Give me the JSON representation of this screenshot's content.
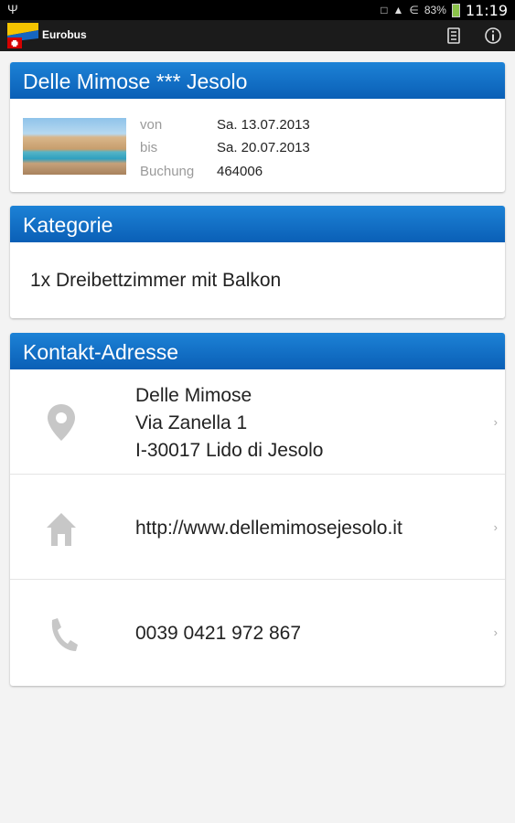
{
  "status_bar": {
    "battery_percent": "83%",
    "time": "11:19"
  },
  "action_bar": {
    "title": "Eurobus"
  },
  "hotel_card": {
    "title": "Delle Mimose *** Jesolo",
    "rows": [
      {
        "label": "von",
        "value": "Sa. 13.07.2013"
      },
      {
        "label": "bis",
        "value": "Sa. 20.07.2013"
      },
      {
        "label": "Buchung",
        "value": "464006"
      }
    ]
  },
  "category_card": {
    "title": "Kategorie",
    "text": "1x Dreibettzimmer mit Balkon"
  },
  "contact_card": {
    "title": "Kontakt-Adresse",
    "address": {
      "line1": "Delle Mimose",
      "line2": "Via Zanella 1",
      "line3": "I-30017 Lido di Jesolo"
    },
    "website": "http://www.dellemimosejesolo.it",
    "phone": "0039 0421 972 867"
  },
  "colors": {
    "header_blue": "#0a6fc8",
    "icon_gray": "#c7c7c7"
  }
}
